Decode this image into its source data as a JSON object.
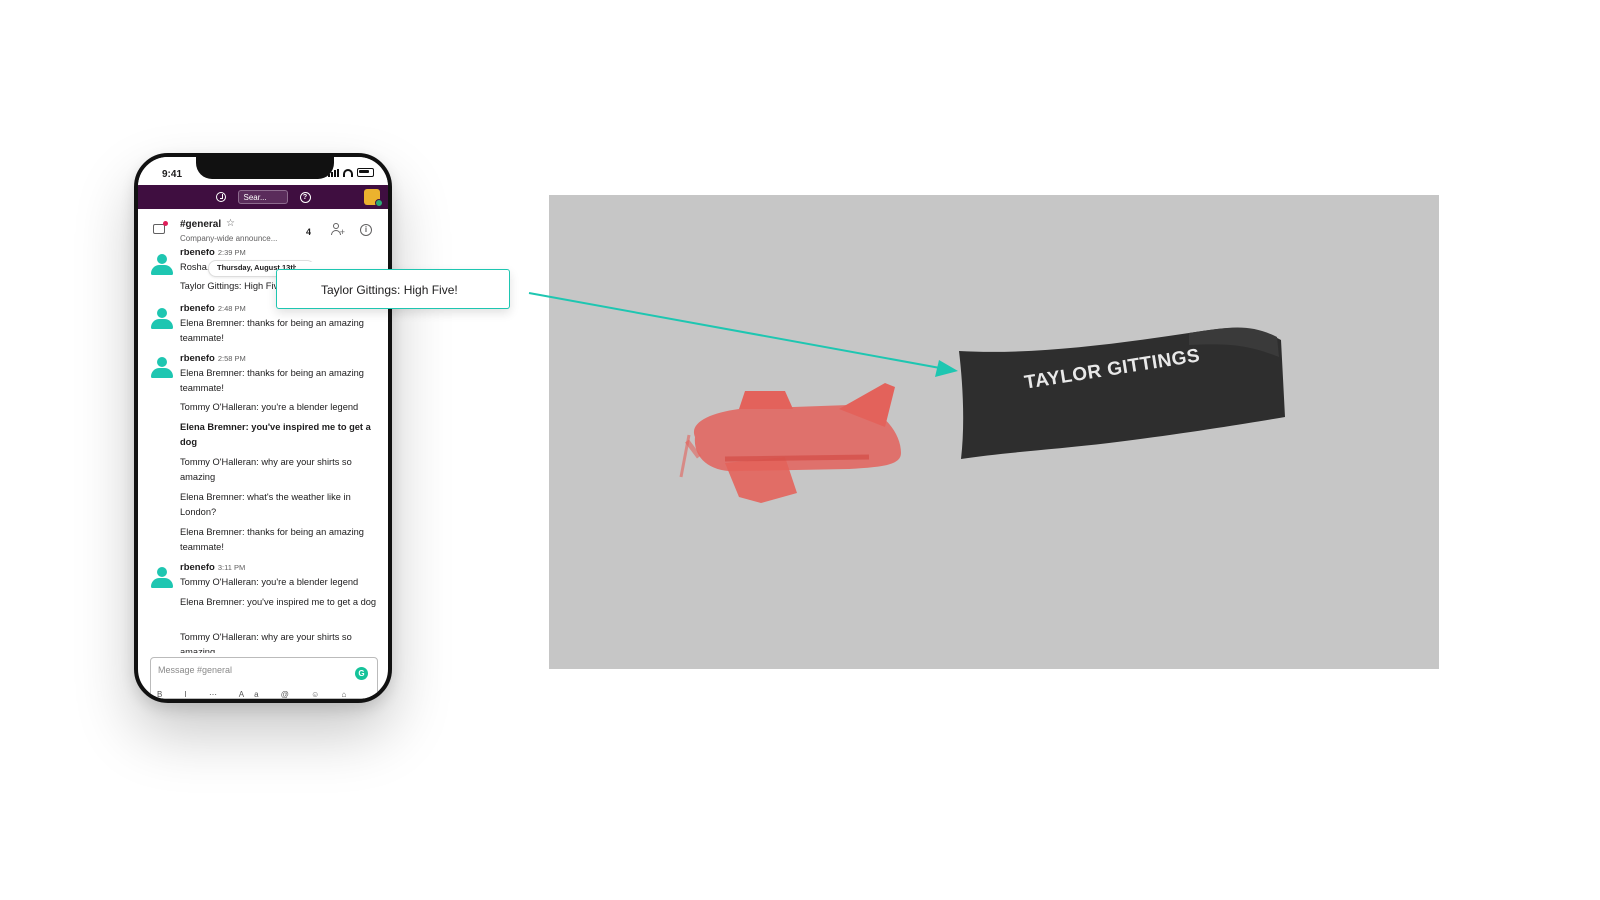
{
  "phone": {
    "status_time": "9:41",
    "topbar": {
      "search_placeholder": "Sear...",
      "help_glyph": "?",
      "history_icon": "clock-icon",
      "avatar_color": "#ecb22e"
    },
    "header": {
      "channel_name": "#general",
      "star": "☆",
      "description": "Company-wide announce...",
      "member_count": "4",
      "info_glyph": "i"
    },
    "date_pill": "Thursday, August 13th ⌄",
    "messages": [
      {
        "author": "rbenefo",
        "time": "2:39 PM",
        "lines": [
          "Rosha..."
        ]
      },
      {
        "text": "Taylor Gittings: High Five!"
      },
      {
        "author": "rbenefo",
        "time": "2:48 PM",
        "lines": [
          "Elena Bremner: thanks for being an amazing",
          "teammate!"
        ]
      },
      {
        "author": "rbenefo",
        "time": "2:58 PM",
        "lines": [
          "Elena Bremner: thanks for being an amazing",
          "teammate!"
        ]
      },
      {
        "text": "Tommy O'Halleran: you're a blender legend"
      },
      {
        "text": "Elena Bremner: you've inspired me to get a dog",
        "bold": true
      },
      {
        "text": "Tommy O'Halleran: why are your shirts so amazing"
      },
      {
        "text": "Elena Bremner: what's the weather like in London?"
      },
      {
        "text": "Elena Bremner: thanks for being an amazing teammate!"
      },
      {
        "author": "rbenefo",
        "time": "3:11 PM",
        "lines": [
          "Tommy O'Halleran: you're a blender legend"
        ]
      },
      {
        "text": "Elena Bremner: you've inspired me to get a dog"
      },
      {
        "text": "Tommy O'Halleran: why are your shirts so amazing"
      }
    ],
    "composer": {
      "placeholder": "Message #general",
      "grammarly_glyph": "G",
      "format_bar": "B I ⋯ Aa @ ☺ ⌂"
    }
  },
  "callout": {
    "text": "Taylor Gittings: High Five!"
  },
  "scene": {
    "banner_text": "TAYLOR GITTINGS",
    "background": "#c6c6c6",
    "plane_color": "#e8554d",
    "banner_color": "#2e2e2e",
    "accent": "#1ec6b1"
  }
}
